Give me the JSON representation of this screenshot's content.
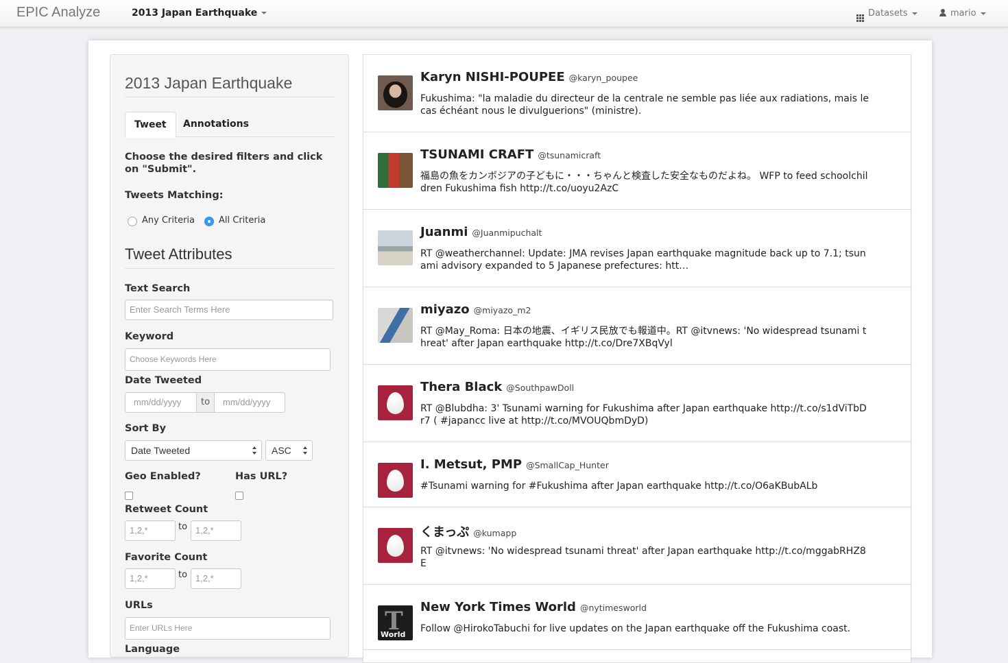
{
  "navbar": {
    "brand": "EPIC Analyze",
    "dataset": "2013 Japan Earthquake",
    "datasets_label": "Datasets",
    "user_label": "mario"
  },
  "sidebar": {
    "title": "2013 Japan Earthquake",
    "tabs": [
      "Tweet",
      "Annotations"
    ],
    "instructions": "Choose the desired filters and click on \"Submit\".",
    "matching_label": "Tweets Matching:",
    "any_label": "Any Criteria",
    "all_label": "All Criteria",
    "attributes_heading": "Tweet Attributes",
    "text_search_label": "Text Search",
    "text_search_placeholder": "Enter Search Terms Here",
    "keyword_label": "Keyword",
    "keyword_placeholder": "Choose Keywords Here",
    "date_label": "Date Tweeted",
    "date_placeholder": "mm/dd/yyyy",
    "to_label": "to",
    "sort_label": "Sort By",
    "sort_value": "Date Tweeted",
    "sort_order": "ASC",
    "geo_label": "Geo Enabled?",
    "url_flag_label": "Has URL?",
    "retweet_label": "Retweet Count",
    "favorite_label": "Favorite Count",
    "count_placeholder": "1,2,*",
    "urls_label": "URLs",
    "urls_placeholder": "Enter URLs Here",
    "language_label": "Language"
  },
  "tweets": [
    {
      "name": "Karyn NISHI-POUPEE",
      "handle": "@karyn_poupee",
      "text": "Fukushima: \"la maladie du directeur de la centrale ne semble pas liée aux radiations, mais le cas échéant nous le divulguerions\" (ministre).",
      "avatar": "photo-woman"
    },
    {
      "name": "TSUNAMI CRAFT",
      "handle": "@tsunamicraft",
      "text": "福島の魚をカンボジアの子どもに・・・ちゃんと検査した安全なものだよね。 WFP to feed schoolchildren Fukushima fish http://t.co/uoyu2AzC",
      "avatar": "photo-shirts"
    },
    {
      "name": "Juanmi",
      "handle": "@Juanmipuchalt",
      "text": "RT @weatherchannel: Update: JMA revises Japan earthquake magnitude back up to 7.1; tsunami advisory expanded to 5 Japanese prefectures: htt…",
      "avatar": "photo-beach"
    },
    {
      "name": "miyazo",
      "handle": "@miyazo_m2",
      "text": "RT @May_Roma: 日本の地震、イギリス民放でも報道中。RT @itvnews: 'No widespread tsunami threat' after Japan earthquake http://t.co/Dre7XBqVyl",
      "avatar": "photo-guitar"
    },
    {
      "name": "Thera Black",
      "handle": "@SouthpawDoll",
      "text": "RT @Blubdha: 3' Tsunami warning for Fukushima after Japan earthquake http://t.co/s1dViTbDr7 ( #japancc live at http://t.co/MVOUQbmDyD)",
      "avatar": "egg"
    },
    {
      "name": "I. Metsut, PMP",
      "handle": "@SmallCap_Hunter",
      "text": "#Tsunami warning for #Fukushima after Japan earthquake http://t.co/O6aKBubALb",
      "avatar": "egg"
    },
    {
      "name": "くまっぷ",
      "handle": "@kumapp",
      "text": "RT @itvnews: 'No widespread tsunami threat' after Japan earthquake http://t.co/mggabRHZ8E",
      "avatar": "egg"
    },
    {
      "name": "New York Times World",
      "handle": "@nytimesworld",
      "text": "Follow @HirokoTabuchi for live updates on the Japan earthquake off the Fukushima coast.",
      "avatar": "nyt-world",
      "avatar_text": "World"
    }
  ]
}
